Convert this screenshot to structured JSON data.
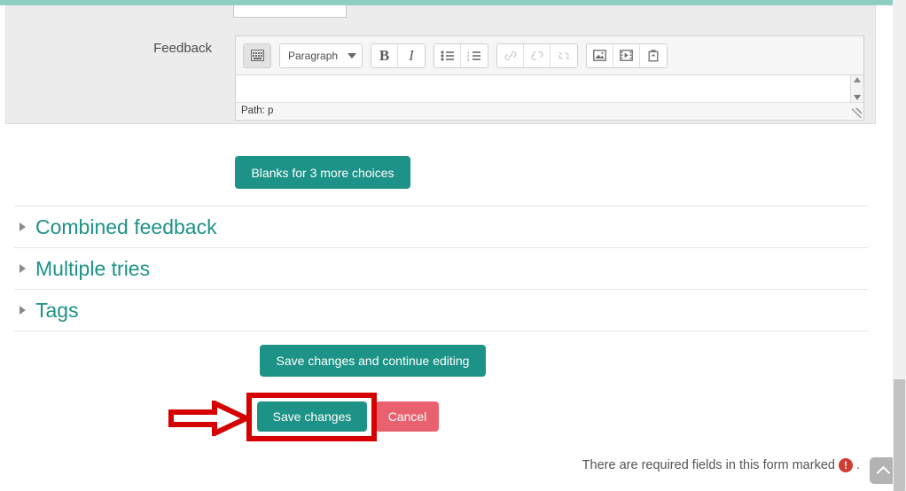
{
  "theme": {
    "accent_teal": "#1d9287",
    "top_bar_mint": "#8ecfc2",
    "danger_red": "#e9616f",
    "annotation_red": "#d60000",
    "required_icon_red": "#d13b32",
    "panel_gray": "#ececec"
  },
  "form": {
    "feedback_field": {
      "label": "Feedback",
      "editor": {
        "format_select_value": "Paragraph",
        "status_path": "Path: p",
        "body_value": "",
        "toolbar": [
          {
            "name": "toggle-toolbars",
            "icon": "keyboard-grid-icon",
            "state": "pressed"
          },
          {
            "name": "format-select",
            "icon": "chevron-down-icon",
            "state": "enabled"
          },
          {
            "name": "bold",
            "icon": "bold-icon",
            "state": "enabled"
          },
          {
            "name": "italic",
            "icon": "italic-icon",
            "state": "enabled"
          },
          {
            "name": "bullet-list",
            "icon": "unordered-list-icon",
            "state": "enabled"
          },
          {
            "name": "numbered-list",
            "icon": "ordered-list-icon",
            "state": "enabled"
          },
          {
            "name": "insert-link",
            "icon": "link-icon",
            "state": "disabled"
          },
          {
            "name": "unlink",
            "icon": "broken-link-icon",
            "state": "disabled"
          },
          {
            "name": "remove-link",
            "icon": "unlink-icon",
            "state": "disabled"
          },
          {
            "name": "insert-image",
            "icon": "image-icon",
            "state": "enabled"
          },
          {
            "name": "insert-media",
            "icon": "film-icon",
            "state": "enabled"
          },
          {
            "name": "manage-files",
            "icon": "folder-upload-icon",
            "state": "enabled"
          }
        ]
      }
    },
    "blanks_button_label": "Blanks for 3 more choices",
    "sections": [
      {
        "title": "Combined feedback",
        "expanded": false,
        "marker": "triangle-right-icon"
      },
      {
        "title": "Multiple tries",
        "expanded": false,
        "marker": "triangle-right-icon"
      },
      {
        "title": "Tags",
        "expanded": false,
        "marker": "triangle-right-icon"
      }
    ],
    "actions": {
      "save_continue_label": "Save changes and continue editing",
      "save_label": "Save changes",
      "cancel_label": "Cancel"
    },
    "required_note": {
      "text": "There are required fields in this form marked",
      "icon": "!",
      "suffix": "."
    }
  },
  "annotation": {
    "highlight_target": "Save changes",
    "arrow_direction": "right",
    "arrow_icon": "arrow-right-outline-icon"
  },
  "to_top_button": {
    "icon": "chevron-up-icon",
    "label": ""
  }
}
